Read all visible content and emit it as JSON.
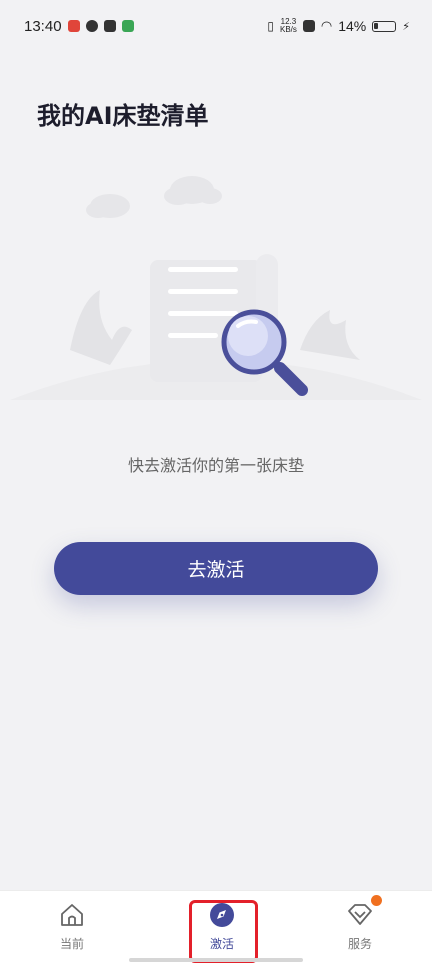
{
  "status_bar": {
    "time": "13:40",
    "net_speed_value": "12.3",
    "net_speed_unit": "KB/s",
    "battery": "14%"
  },
  "page": {
    "title": "我的AI床垫清单",
    "empty_message": "快去激活你的第一张床垫",
    "activate_button": "去激活"
  },
  "bottom_nav": {
    "items": [
      {
        "label": "当前",
        "icon": "home-icon"
      },
      {
        "label": "激活",
        "icon": "compass-icon"
      },
      {
        "label": "服务",
        "icon": "service-icon"
      }
    ],
    "active_index": 1
  },
  "colors": {
    "accent": "#434a9a",
    "background": "#f2f2f4",
    "highlight": "#e3202a",
    "badge": "#f07020"
  }
}
